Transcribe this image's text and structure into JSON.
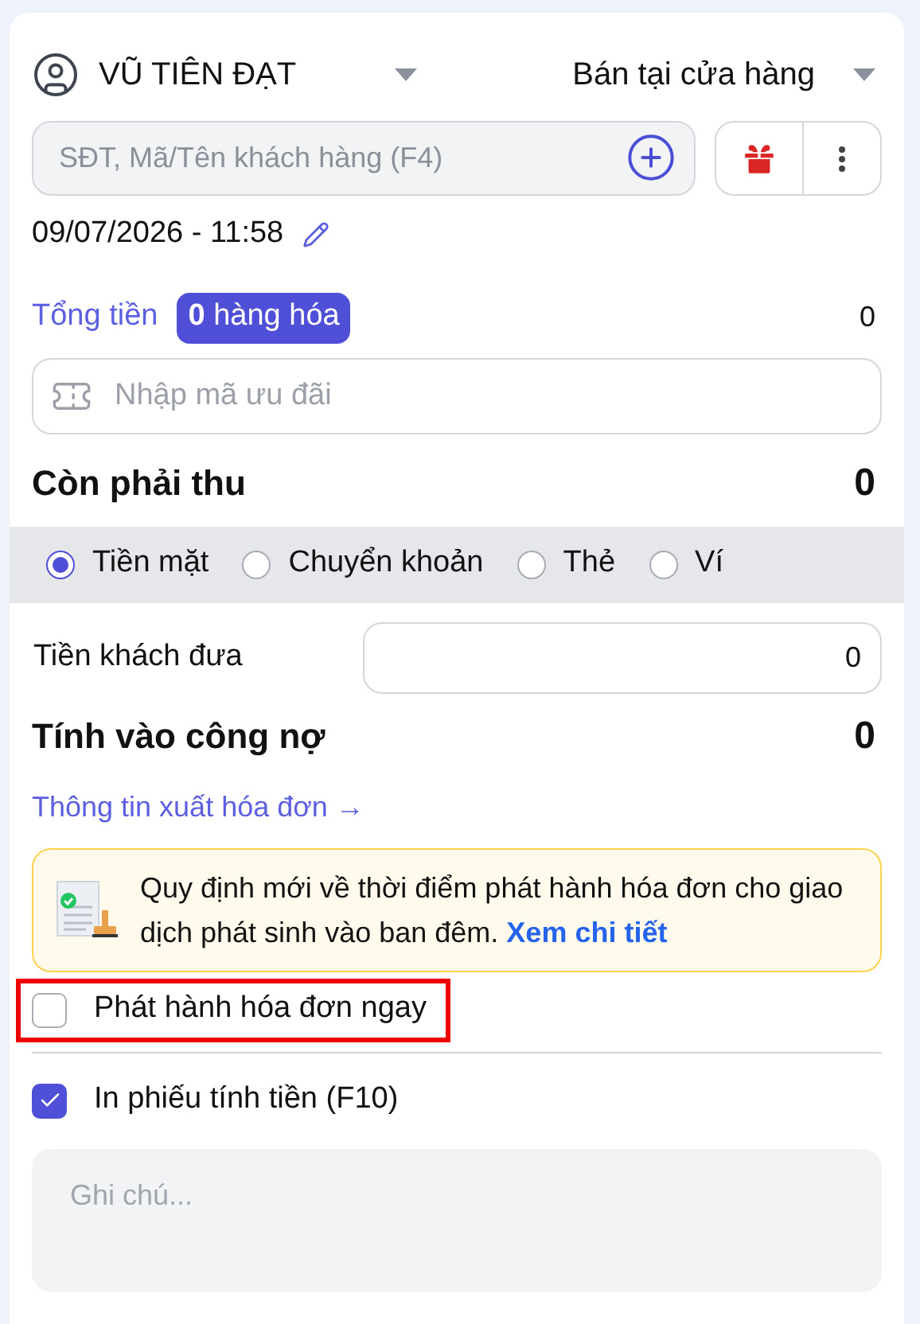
{
  "header": {
    "user": "VŨ TIÊN ĐẠT",
    "channel": "Bán tại cửa hàng"
  },
  "customer_search": {
    "placeholder": "SĐT, Mã/Tên khách hàng (F4)"
  },
  "datetime": "09/07/2026 - 11:58",
  "total": {
    "label": "Tổng tiền",
    "badge_count": "0",
    "badge_text": "hàng hóa",
    "value": "0"
  },
  "coupon": {
    "placeholder": "Nhập mã ưu đãi"
  },
  "due": {
    "label": "Còn phải thu",
    "value": "0"
  },
  "payment_methods": [
    {
      "label": "Tiền mặt",
      "selected": true
    },
    {
      "label": "Chuyển khoản",
      "selected": false
    },
    {
      "label": "Thẻ",
      "selected": false
    },
    {
      "label": "Ví",
      "selected": false
    }
  ],
  "customer_paid": {
    "label": "Tiền khách đưa",
    "value": "0"
  },
  "debt": {
    "label": "Tính vào công nợ",
    "value": "0"
  },
  "invoice_link": "Thông tin xuất hóa đơn →",
  "notice": {
    "text": "Quy định mới về thời điểm phát hành hóa đơn cho giao dịch phát sinh vào ban đêm.",
    "link": "Xem chi tiết"
  },
  "options": [
    {
      "label": "Phát hành hóa đơn ngay",
      "checked": false,
      "highlighted": true
    },
    {
      "label": "In phiếu tính tiền (F10)",
      "checked": true,
      "highlighted": false
    }
  ],
  "note": {
    "placeholder": "Ghi chú..."
  }
}
